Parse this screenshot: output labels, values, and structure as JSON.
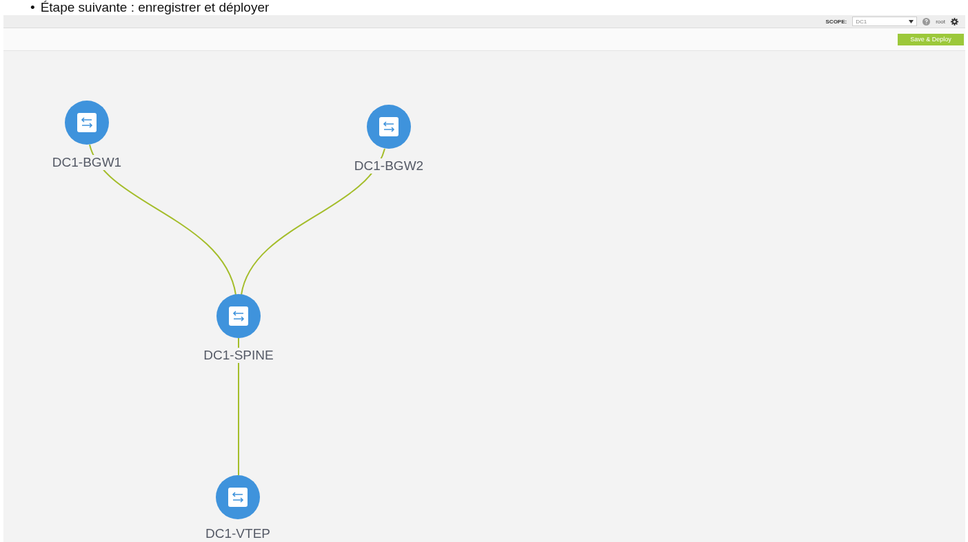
{
  "slide_bullet": "•",
  "slide_title": "Étape suivante : enregistrer et déployer",
  "header": {
    "scope_label": "SCOPE:",
    "scope_value": "DC1",
    "user": "root"
  },
  "toolbar": {
    "button": "Save & Deploy"
  },
  "topology": {
    "nodes": [
      {
        "label": "DC1-BGW1"
      },
      {
        "label": "DC1-BGW2"
      },
      {
        "label": "DC1-SPINE"
      },
      {
        "label": "DC1-VTEP"
      }
    ]
  }
}
